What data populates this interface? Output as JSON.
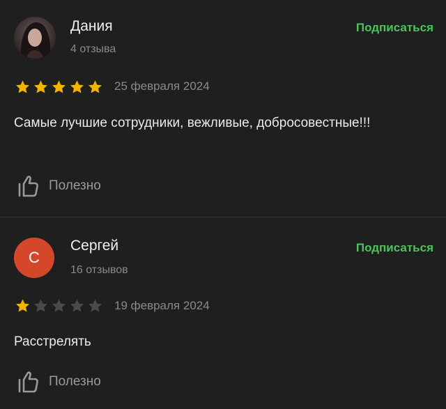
{
  "colors": {
    "background": "#1f1f1f",
    "accent_green": "#4fc25a",
    "star_filled": "#f2b400",
    "star_empty": "#4a4a4a",
    "avatar_sergey": "#d5472a",
    "secondary_text": "#8a8a8a"
  },
  "reviews": [
    {
      "author": "Дания",
      "review_count": "4 отзыва",
      "subscribe_label": "Подписаться",
      "rating": 5,
      "date": "25 февраля 2024",
      "text": "Самые лучшие сотрудники, вежливые, добросовестные!!!",
      "helpful_label": "Полезно",
      "avatar": "photo"
    },
    {
      "author": "Сергей",
      "avatar_letter": "С",
      "review_count": "16 отзывов",
      "subscribe_label": "Подписаться",
      "rating": 1,
      "date": "19 февраля 2024",
      "text": "Расстрелять",
      "helpful_label": "Полезно",
      "avatar": "letter"
    }
  ],
  "icons": {
    "star": "star-icon",
    "helpful": "thumbs-up-icon"
  }
}
